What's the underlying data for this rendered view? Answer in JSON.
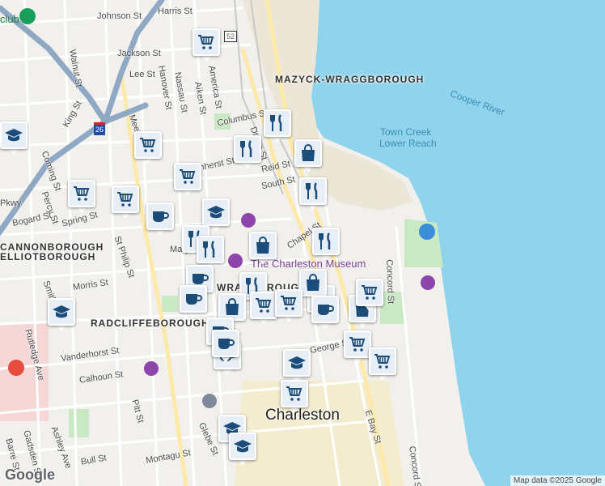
{
  "map": {
    "colors": {
      "water": "#8fd3ec",
      "land": "#f2f0ec",
      "park": "#c9e8c4",
      "highway": "#8fa8c4",
      "marker_icon": "#1c4d7a",
      "hospital": "#e84c3d",
      "poi": "#8e44ad"
    },
    "neighborhoods": [
      "MAZYCK-WRAGGBOROUGH",
      "CANNONBOROUGH",
      "ELLIOTBOROUGH",
      "RADCLIFFEBOROUGH",
      "WRAGBOROUGH"
    ],
    "city": "Charleston",
    "water_labels": [
      "Cooper River",
      "Town Creek",
      "Lower Reach"
    ],
    "poi_labels": [
      "The Charleston Museum",
      "club"
    ],
    "shield": "52",
    "highway_shield": "26",
    "streets": [
      "Johnson St",
      "Harris St",
      "Jackson St",
      "Walnut St",
      "Lee St",
      "Hanover St",
      "Nassau St",
      "Aiken St",
      "America St",
      "King St",
      "Meeting St",
      "Columbus St",
      "Drake St",
      "Amherst St",
      "Reid St",
      "South St",
      "Coming St",
      "Percy St",
      "Spring St",
      "Bogard St",
      "St Philip St",
      "Mary St",
      "Chapel St",
      "Morris St",
      "Smith St",
      "Rutledge Ave",
      "Vanderhorst St",
      "Calhoun St",
      "Pitt St",
      "George St",
      "Glebe St",
      "Concord St",
      "E Bay St",
      "Ashley Ave",
      "Barre St",
      "Gadsden St",
      "Bull St",
      "Montagu St",
      "Concord St",
      "Pkwy"
    ],
    "markers": [
      "grocery",
      "restaurant",
      "restaurant",
      "shopping",
      "restaurant",
      "grocery",
      "grocery",
      "grocery",
      "coffee",
      "school",
      "restaurant",
      "restaurant",
      "shopping",
      "restaurant",
      "coffee",
      "coffee",
      "school",
      "restaurant",
      "shopping",
      "shopping",
      "shopping",
      "coffee",
      "shopping",
      "grocery",
      "coffee",
      "coffee",
      "grocery",
      "grocery",
      "school",
      "grocery",
      "school",
      "school",
      "school",
      "coffee",
      "grocery",
      "grocery",
      "grocery"
    ],
    "attribution": "Map data ©2025 Google",
    "logo": "Google"
  }
}
